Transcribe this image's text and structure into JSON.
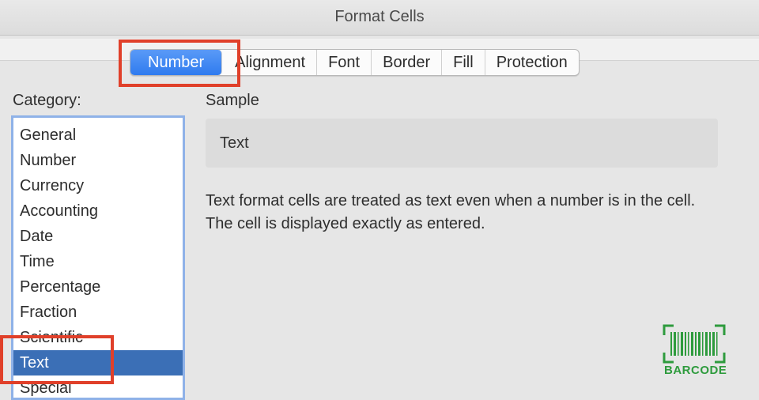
{
  "window": {
    "title": "Format Cells"
  },
  "tabs": [
    {
      "label": "Number",
      "active": true
    },
    {
      "label": "Alignment",
      "active": false
    },
    {
      "label": "Font",
      "active": false
    },
    {
      "label": "Border",
      "active": false
    },
    {
      "label": "Fill",
      "active": false
    },
    {
      "label": "Protection",
      "active": false
    }
  ],
  "category": {
    "label": "Category:",
    "items": [
      "General",
      "Number",
      "Currency",
      "Accounting",
      "Date",
      "Time",
      "Percentage",
      "Fraction",
      "Scientific",
      "Text",
      "Special"
    ],
    "selected": "Text"
  },
  "sample": {
    "label": "Sample",
    "value": "Text"
  },
  "description": {
    "line1": "Text format cells are treated as text even when a number is in the cell.",
    "line2": "The cell is displayed exactly as entered."
  },
  "watermark": {
    "text": "BARCODE"
  },
  "colors": {
    "accent": "#2f7bef",
    "selection": "#3b6fb6",
    "highlight_box": "#e0402a",
    "logo": "#2e9b3d"
  }
}
